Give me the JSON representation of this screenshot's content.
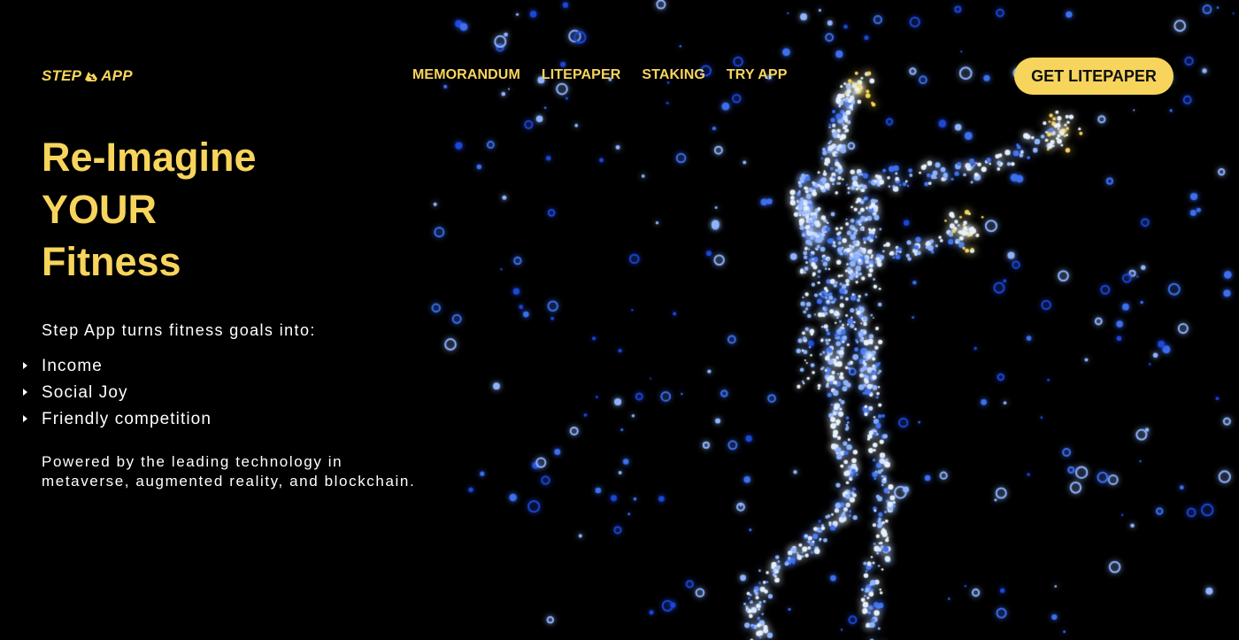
{
  "brand": {
    "logo_left": "STEP",
    "logo_right": "APP",
    "accent_color": "#f7d55c"
  },
  "nav": {
    "items": [
      {
        "label": "MEMORANDUM"
      },
      {
        "label": "LITEPAPER"
      },
      {
        "label": "STAKING"
      },
      {
        "label": "TRY APP"
      }
    ]
  },
  "cta": {
    "label": "GET LITEPAPER"
  },
  "hero": {
    "title_lines": [
      "Re-Imagine",
      "YOUR",
      "Fitness"
    ]
  },
  "content": {
    "intro": "Step App turns fitness goals into:",
    "bullets": [
      "Income",
      "Social Joy",
      "Friendly competition"
    ],
    "powered": "Powered by the leading technology in metaverse, augmented reality, and blockchain."
  },
  "background": {
    "description_icon": "particle-runner-figure",
    "particle_colors": [
      "#1e47d8",
      "#3d6ff0",
      "#8fb4ff",
      "#e8f2ff",
      "#f7d55c"
    ]
  }
}
